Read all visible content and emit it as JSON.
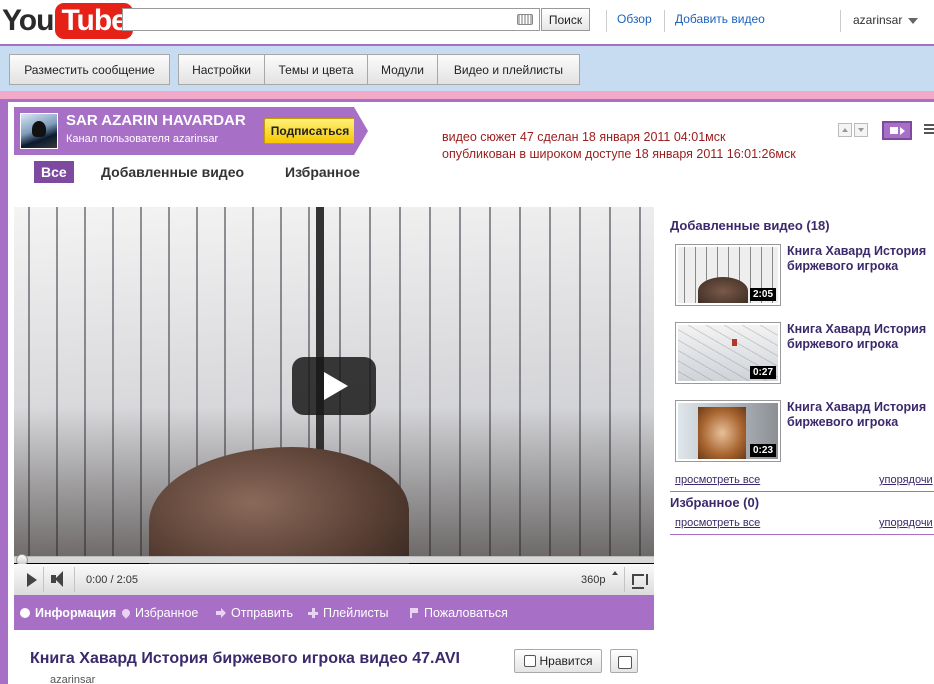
{
  "masthead": {
    "logo_you": "You",
    "logo_tube": "Tube",
    "search_placeholder": "",
    "search_button": "Поиск",
    "browse_link": "Обзор",
    "upload_link": "Добавить видео",
    "username": "azarinsar"
  },
  "channel_bar": {
    "buttons": [
      "Разместить сообщение",
      "Настройки",
      "Темы и цвета",
      "Модули",
      "Видео и плейлисты"
    ]
  },
  "profile": {
    "name": "SAR AZARIN HAVARDAR",
    "subtitle": "Канал пользователя azarinsar",
    "subscribe": "Подписаться"
  },
  "meta": {
    "line1": "видео сюжет 47 сделан 18 января 2011 04:01мск",
    "line2": "опубликован в широком доступе 18 января 2011 16:01:26мск"
  },
  "tabs": [
    "Все",
    "Добавленные видео",
    "Избранное"
  ],
  "player": {
    "time": "0:00 / 2:05",
    "quality": "360p",
    "progress_fraction": 0
  },
  "actions": [
    "Информация",
    "Избранное",
    "Отправить",
    "Плейлисты",
    "Пожаловаться"
  ],
  "video_info": {
    "title": "Книга Хавард История биржевого игрока видео 47.AVI",
    "author": "azarinsar",
    "like": "Нравится"
  },
  "right_panel": {
    "uploads_heading": "Добавленные видео (18)",
    "uploads": [
      {
        "title": "Книга Хавард История биржевого игрока",
        "duration": "2:05"
      },
      {
        "title": "Книга Хавард История биржевого игрока",
        "duration": "0:27"
      },
      {
        "title": "Книга Хавард История биржевого игрока",
        "duration": "0:23"
      }
    ],
    "see_all": "просмотреть все",
    "sort": "упорядочи",
    "favorites_heading": "Избранное (0)",
    "fav_see_all": "просмотреть все",
    "fav_sort": "упорядочи"
  },
  "colors": {
    "accent": "#a86fc7",
    "accent_dark": "#7d4aa0",
    "title_text": "#3b2a6b",
    "meta_text": "#9b1c1c"
  }
}
